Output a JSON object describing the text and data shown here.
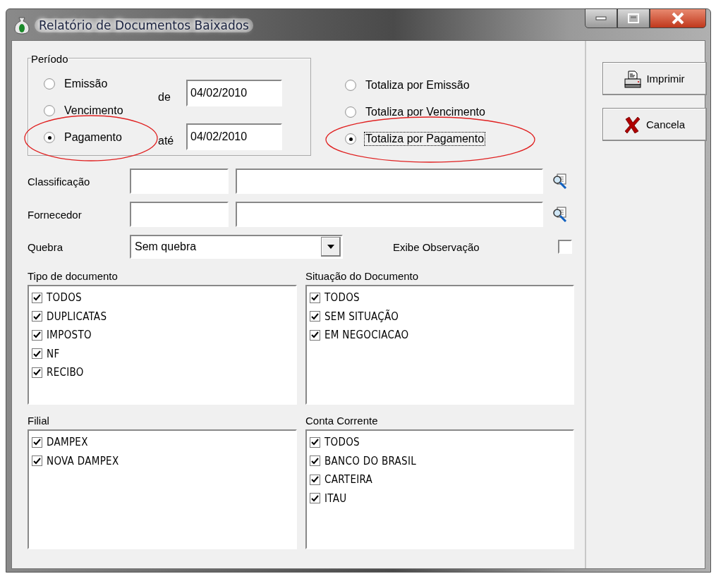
{
  "window": {
    "title": "Relatório de Documentos Baixados"
  },
  "periodo": {
    "label": "Período",
    "options": [
      {
        "label": "Emissão",
        "selected": false,
        "circled": false
      },
      {
        "label": "Vencimento",
        "selected": false,
        "circled": false
      },
      {
        "label": "Pagamento",
        "selected": true,
        "circled": true
      }
    ],
    "dates": [
      {
        "label": "de",
        "value": "04/02/2010"
      },
      {
        "label": "até",
        "value": "04/02/2010"
      }
    ]
  },
  "totaliza": {
    "options": [
      {
        "label": "Totaliza por Emissão",
        "selected": false,
        "circled": false,
        "focused": false
      },
      {
        "label": "Totaliza por Vencimento",
        "selected": false,
        "circled": false,
        "focused": false
      },
      {
        "label": "Totaliza por Pagamento",
        "selected": true,
        "circled": true,
        "focused": true
      }
    ]
  },
  "buttons": [
    {
      "label": "Imprimir",
      "kind": "print"
    },
    {
      "label": "Cancela",
      "kind": "cancel"
    }
  ],
  "lookups": [
    {
      "label": "Classificação"
    },
    {
      "label": "Fornecedor"
    }
  ],
  "quebra": {
    "label": "Quebra",
    "value": "Sem quebra"
  },
  "exibe_observacao": {
    "label": "Exibe Observação",
    "checked": false
  },
  "lists": [
    {
      "title": "Tipo de documento",
      "items": [
        {
          "label": "TODOS",
          "checked": true
        },
        {
          "label": "DUPLICATAS",
          "checked": true
        },
        {
          "label": "IMPOSTO",
          "checked": true
        },
        {
          "label": "NF",
          "checked": true
        },
        {
          "label": "RECIBO",
          "checked": true
        }
      ]
    },
    {
      "title": "Situação do Documento",
      "items": [
        {
          "label": "TODOS",
          "checked": true
        },
        {
          "label": "SEM SITUAÇÃO",
          "checked": true
        },
        {
          "label": "EM NEGOCIACAO",
          "checked": true
        }
      ]
    },
    {
      "title": "Filial",
      "items": [
        {
          "label": "DAMPEX",
          "checked": true
        },
        {
          "label": "NOVA DAMPEX",
          "checked": true
        }
      ]
    },
    {
      "title": "Conta Corrente",
      "items": [
        {
          "label": "TODOS",
          "checked": true
        },
        {
          "label": "BANCO DO BRASIL",
          "checked": true
        },
        {
          "label": "CARTEIRA",
          "checked": true
        },
        {
          "label": "ITAU",
          "checked": true
        }
      ]
    }
  ]
}
